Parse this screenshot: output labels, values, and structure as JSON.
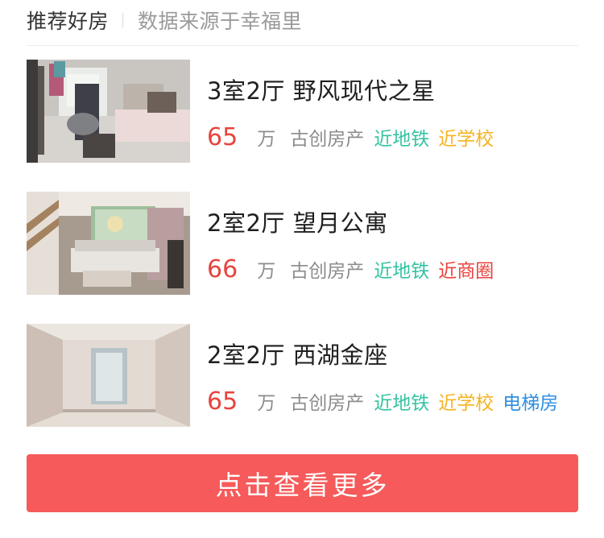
{
  "header": {
    "title": "推荐好房",
    "source": "数据来源于幸福里"
  },
  "listings": [
    {
      "title": "3室2厅 野风现代之星",
      "price": "65",
      "unit": "万",
      "agency": "古创房产",
      "tags": [
        {
          "text": "近地铁",
          "color": "#35c3a2"
        },
        {
          "text": "近学校",
          "color": "#f5b321"
        }
      ]
    },
    {
      "title": "2室2厅 望月公寓",
      "price": "66",
      "unit": "万",
      "agency": "古创房产",
      "tags": [
        {
          "text": "近地铁",
          "color": "#35c3a2"
        },
        {
          "text": "近商圈",
          "color": "#e8433e"
        }
      ]
    },
    {
      "title": "2室2厅 西湖金座",
      "price": "65",
      "unit": "万",
      "agency": "古创房产",
      "tags": [
        {
          "text": "近地铁",
          "color": "#35c3a2"
        },
        {
          "text": "近学校",
          "color": "#f5b321"
        },
        {
          "text": "电梯房",
          "color": "#2f8fe0"
        }
      ]
    }
  ],
  "more_button": {
    "label": "点击查看更多"
  }
}
